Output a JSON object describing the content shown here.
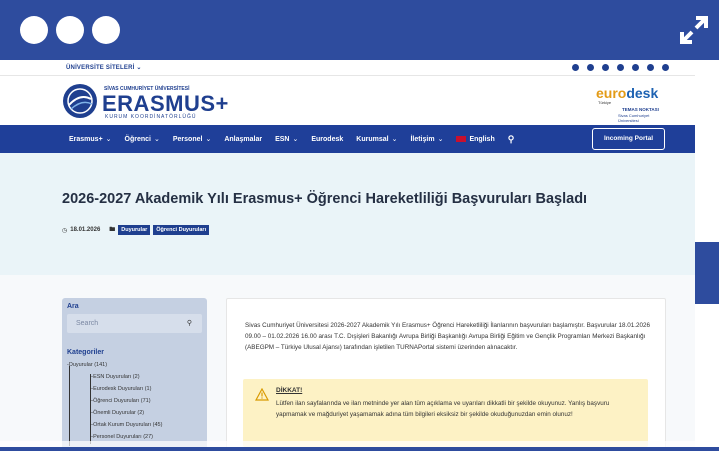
{
  "header": {
    "univ_links": "ÜNİVERSİTE SİTELERİ",
    "univ_caret": "⌄",
    "social_icons": [
      "youtube-icon",
      "facebook-icon",
      "instagram-icon",
      "x-icon",
      "linkedin-icon",
      "telegram-icon",
      "web-icon"
    ]
  },
  "logo": {
    "university": "SİVAS CUMHURİYET ÜNİVERSİTESİ",
    "name": "ERASMUS+",
    "subtitle": "KURUM KOORDİNATÖRLÜĞÜ"
  },
  "eurodesk": {
    "euro": "euro",
    "desk": "desk",
    "country": "Türkiye",
    "contact": "TEMAS NOKTASI",
    "sub": "Sivas Cumhuriyet Üniversitesi"
  },
  "nav": {
    "items": [
      {
        "label": "Erasmus+",
        "caret": "⌄"
      },
      {
        "label": "Öğrenci",
        "caret": "⌄"
      },
      {
        "label": "Personel",
        "caret": "⌄"
      },
      {
        "label": "Anlaşmalar",
        "caret": ""
      },
      {
        "label": "ESN",
        "caret": "⌄"
      },
      {
        "label": "Eurodesk",
        "caret": ""
      },
      {
        "label": "Kurumsal",
        "caret": "⌄"
      },
      {
        "label": "İletişim",
        "caret": "⌄"
      }
    ],
    "english": "English",
    "portal_button": "Incoming Portal"
  },
  "hero": {
    "title": "2026-2027 Akademik Yılı Erasmus+ Öğrenci Hareketliliği Başvuruları Başladı",
    "date": "18.01.2026",
    "tags": [
      "Duyurular",
      "Öğrenci Duyuruları"
    ]
  },
  "sidebar": {
    "search_label": "Ara",
    "search_placeholder": "Search",
    "categories_label": "Kategoriler",
    "categories": [
      {
        "label": "Duyurular (141)",
        "level": 0
      },
      {
        "label": "ESN Duyuruları (2)",
        "level": 1
      },
      {
        "label": "Eurodesk Duyuruları (1)",
        "level": 1
      },
      {
        "label": "Öğrenci Duyuruları (71)",
        "level": 1
      },
      {
        "label": "Önemli Duyurular (2)",
        "level": 1
      },
      {
        "label": "Ortak Kurum Duyuruları (45)",
        "level": 1
      },
      {
        "label": "Personel Duyuruları (27)",
        "level": 1
      }
    ]
  },
  "article": {
    "paragraph": "Sivas Cumhuriyet Üniversitesi 2026-2027 Akademik Yılı Erasmus+ Öğrenci Hareketliliği İlanlarının başvuruları başlamıştır. Başvurular 18.01.2026 09.00 – 01.02.2026 16.00 arası T.C. Dışişleri Bakanlığı Avrupa Birliği Başkanlığı Avrupa Birliği Eğitim ve Gençlik Programları Merkezi Başkanlığı (ABEGPM – Türkiye Ulusal Ajansı) tarafından işletilen TURNAPortal sistemi üzerinden alınacaktır.",
    "warning_title": "DİKKAT!",
    "warning_text": "Lütfen ilan sayfalarında ve ilan metninde yer alan tüm açıklama ve uyarıları dikkatli bir şekilde okuyunuz. Yanlış başvuru yapmamak ve mağduriyet yaşamamak adına tüm bilgileri eksiksiz bir şekilde okuduğunuzdan emin olunuz!"
  },
  "colors": {
    "frame": "#2e4c9e",
    "nav": "#1f3f99",
    "brand": "#1f3f8f",
    "hero_bg": "#eaf4f8",
    "warning_bg": "#fdf2c5"
  }
}
